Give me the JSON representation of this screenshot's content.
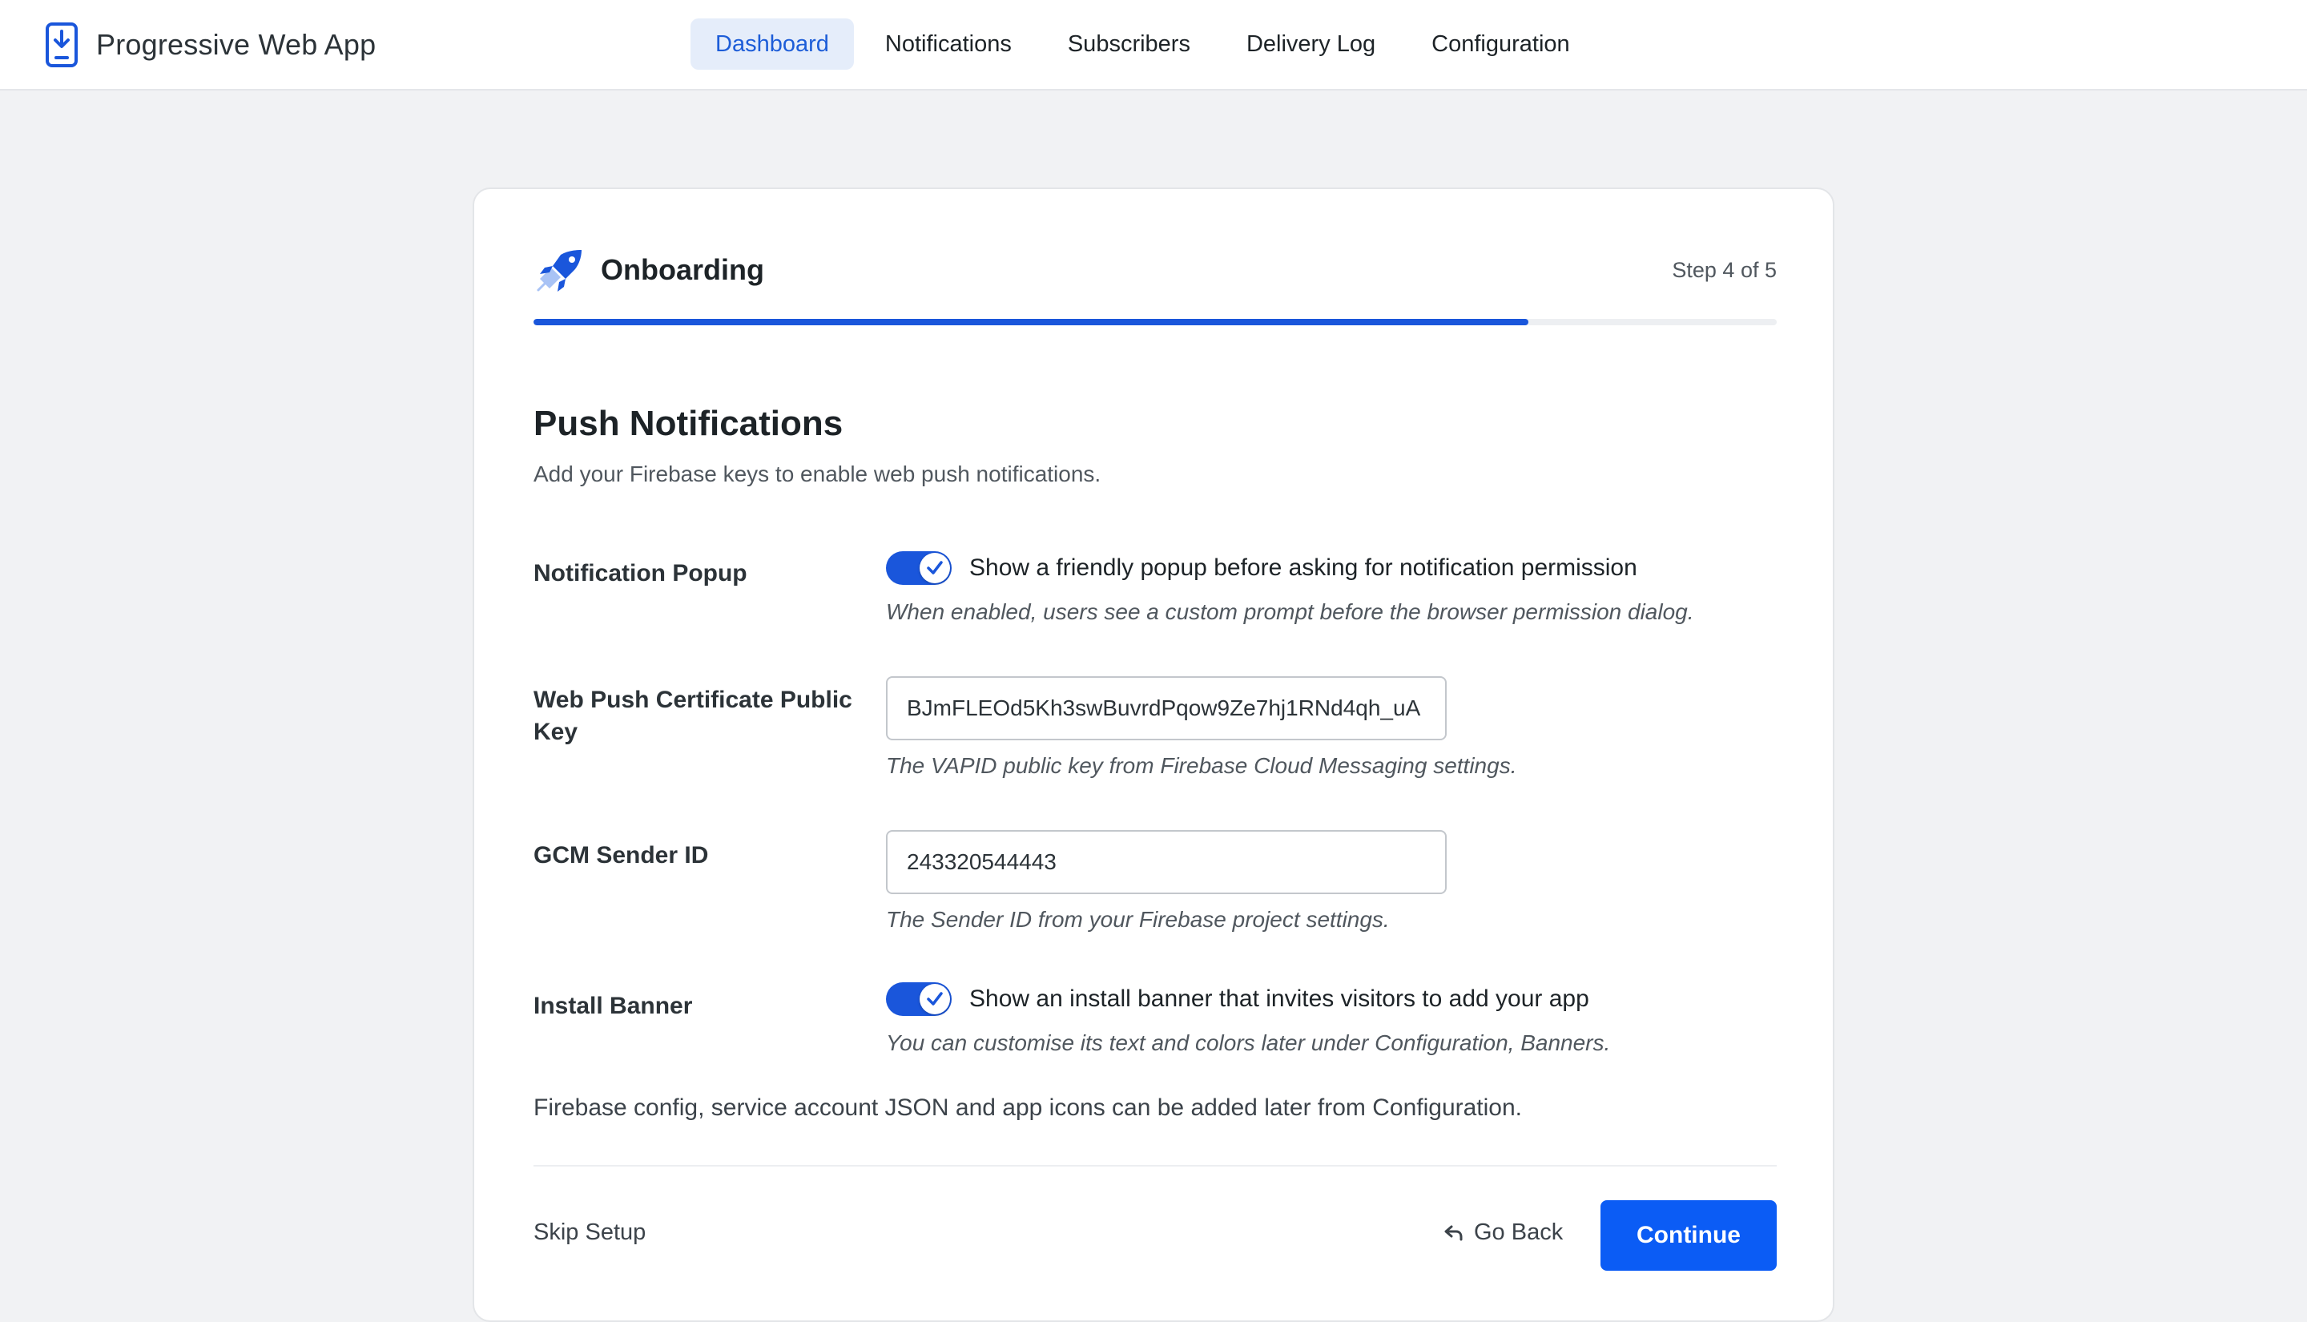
{
  "app": {
    "name": "Progressive Web App",
    "icon": "phone-download-icon"
  },
  "nav": {
    "items": [
      {
        "label": "Dashboard",
        "active": true
      },
      {
        "label": "Notifications",
        "active": false
      },
      {
        "label": "Subscribers",
        "active": false
      },
      {
        "label": "Delivery Log",
        "active": false
      },
      {
        "label": "Configuration",
        "active": false
      }
    ]
  },
  "onboarding": {
    "title": "Onboarding",
    "icon": "rocket-icon",
    "step_text": "Step 4 of 5",
    "progress_fraction": 0.8
  },
  "section": {
    "title": "Push Notifications",
    "subtitle": "Add your Firebase keys to enable web push notifications."
  },
  "fields": {
    "popup": {
      "label": "Notification Popup",
      "enabled": true,
      "toggle_text": "Show a friendly popup before asking for notification permission",
      "help": "When enabled, users see a custom prompt before the browser permission dialog."
    },
    "public_key": {
      "label": "Web Push Certificate Public Key",
      "value": "BJmFLEOd5Kh3swBuvrdPqow9Ze7hj1RNd4qh_uA",
      "help": "The VAPID public key from Firebase Cloud Messaging settings."
    },
    "sender_id": {
      "label": "GCM Sender ID",
      "value": "243320544443",
      "help": "The Sender ID from your Firebase project settings."
    },
    "install_banner": {
      "label": "Install Banner",
      "enabled": true,
      "toggle_text": "Show an install banner that invites visitors to add your app",
      "help": "You can customise its text and colors later under Configuration, Banners."
    }
  },
  "note": "Firebase config, service account JSON and app icons can be added later from Configuration.",
  "footer": {
    "skip_label": "Skip Setup",
    "back_label": "Go Back",
    "continue_label": "Continue"
  },
  "colors": {
    "accent": "#1a56db",
    "button": "#0b5cf5",
    "nav_active_bg": "#e5edfa"
  }
}
